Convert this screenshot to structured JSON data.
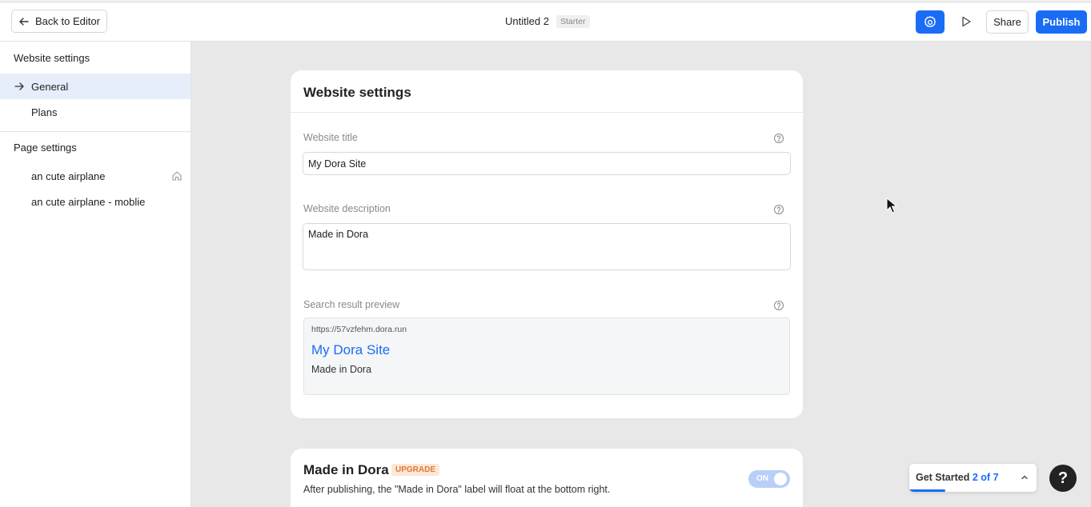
{
  "topbar": {
    "back_label": "Back to Editor",
    "doc_title": "Untitled 2",
    "plan_badge": "Starter",
    "share_label": "Share",
    "publish_label": "Publish"
  },
  "sidebar": {
    "website_heading": "Website settings",
    "website_items": [
      {
        "label": "General",
        "active": true
      },
      {
        "label": "Plans",
        "active": false
      }
    ],
    "page_heading": "Page settings",
    "page_items": [
      {
        "label": "an cute airplane",
        "is_home": true
      },
      {
        "label": "an cute airplane - moblie",
        "is_home": false
      }
    ]
  },
  "website_settings_card": {
    "title": "Website settings",
    "title_field": {
      "label": "Website title",
      "value": "My Dora Site"
    },
    "description_field": {
      "label": "Website description",
      "value": "Made in Dora"
    },
    "preview": {
      "label": "Search result preview",
      "url": "https://57vzfehm.dora.run",
      "title": "My Dora Site",
      "description": "Made in Dora"
    }
  },
  "made_in_dora_card": {
    "title": "Made in Dora",
    "badge": "UPGRADE",
    "description": "After publishing, the \"Made in Dora\" label will float at the bottom right.",
    "toggle_label": "ON",
    "toggle_on": true
  },
  "get_started": {
    "label": "Get Started",
    "progress_text": "2 of 7",
    "progress_fraction": 0.2857
  },
  "help_button": {
    "label": "?"
  },
  "colors": {
    "accent": "#1a6cf5",
    "sidebar_active": "#e6eefc",
    "upgrade_text": "#e07a3a",
    "upgrade_bg": "#fde7d6",
    "toggle_on": "#b8cff8"
  },
  "icons": {
    "back": "arrow-left-icon",
    "settings": "gear-icon",
    "preview": "play-icon",
    "active_item": "arrow-right-icon",
    "home": "home-icon",
    "help": "question-circle-icon",
    "expand": "chevron-up-icon"
  }
}
